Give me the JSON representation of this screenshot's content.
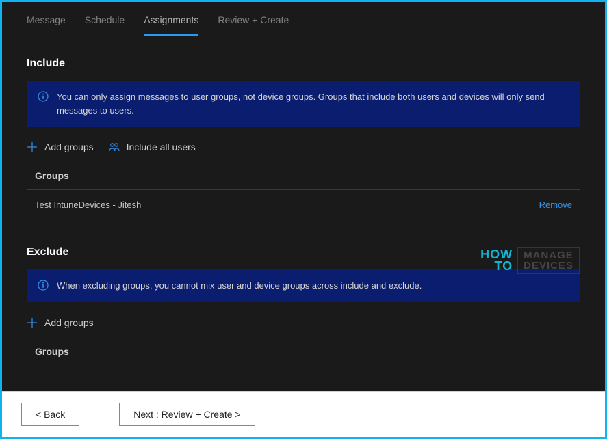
{
  "tabs": {
    "message": "Message",
    "schedule": "Schedule",
    "assignments": "Assignments",
    "review": "Review + Create"
  },
  "include": {
    "title": "Include",
    "info": "You can only assign messages to user groups, not device groups. Groups that include both users and devices will only send messages to users.",
    "addGroups": "Add groups",
    "includeAll": "Include all users",
    "groupsLabel": "Groups",
    "rows": [
      {
        "name": "Test IntuneDevices - Jitesh",
        "remove": "Remove"
      }
    ]
  },
  "exclude": {
    "title": "Exclude",
    "info": "When excluding groups, you cannot mix user and device groups across include and exclude.",
    "addGroups": "Add groups",
    "groupsLabel": "Groups"
  },
  "footer": {
    "back": "< Back",
    "next": "Next : Review + Create >"
  },
  "watermark": {
    "how": "HOW",
    "to": "TO",
    "l1": "MANAGE",
    "l2": "DEVICES"
  }
}
